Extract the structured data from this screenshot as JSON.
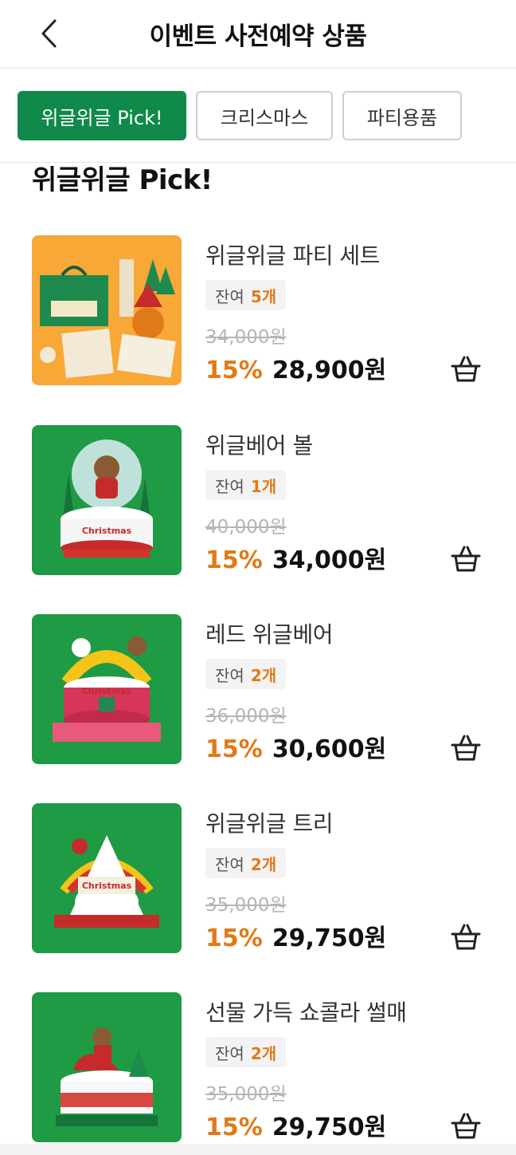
{
  "header": {
    "title": "이벤트 사전예약 상품",
    "back_icon": "chevron-left-icon"
  },
  "tabs": [
    {
      "label": "위글위글 Pick!",
      "active": true
    },
    {
      "label": "크리스마스",
      "active": false
    },
    {
      "label": "파티용품",
      "active": false
    }
  ],
  "section": {
    "title": "위글위글 Pick!"
  },
  "stock_label": "잔여",
  "colors": {
    "accent": "#0f8a4a",
    "discount": "#e07a18"
  },
  "products": [
    {
      "name": "위글위글 파티 세트",
      "stock": "5개",
      "original_price": "34,000원",
      "discount": "15%",
      "price": "28,900원",
      "image": "party-set-image",
      "cart_icon": "basket-icon"
    },
    {
      "name": "위글베어 볼",
      "stock": "1개",
      "original_price": "40,000원",
      "discount": "15%",
      "price": "34,000원",
      "image": "bear-ball-cake-image",
      "cart_icon": "basket-icon"
    },
    {
      "name": "레드 위글베어",
      "stock": "2개",
      "original_price": "36,000원",
      "discount": "15%",
      "price": "30,600원",
      "image": "red-bear-cake-image",
      "cart_icon": "basket-icon"
    },
    {
      "name": "위글위글 트리",
      "stock": "2개",
      "original_price": "35,000원",
      "discount": "15%",
      "price": "29,750원",
      "image": "tree-cake-image",
      "cart_icon": "basket-icon"
    },
    {
      "name": "선물 가득 쇼콜라 썰매",
      "stock": "2개",
      "original_price": "35,000원",
      "discount": "15%",
      "price": "29,750원",
      "image": "sleigh-cake-image",
      "cart_icon": "basket-icon"
    }
  ]
}
